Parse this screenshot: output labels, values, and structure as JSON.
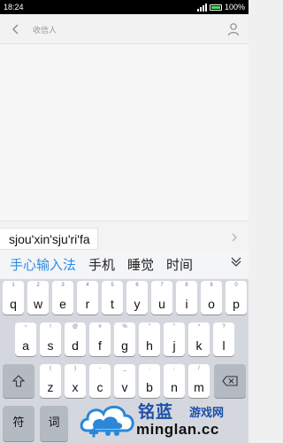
{
  "status_bar": {
    "time": "18:24",
    "battery": "100%"
  },
  "header": {
    "recipient_placeholder": "收信人",
    "back_icon": "chevron-left-icon",
    "contact_icon": "person-icon"
  },
  "compose": {
    "pinyin": "sjou'xin'sju'ri'fa",
    "send_icon": "chevron-right-icon"
  },
  "candidates": {
    "items": [
      "手心输入法",
      "手机",
      "睡觉",
      "时间"
    ],
    "expand_icon": "chevron-down-icon"
  },
  "keyboard": {
    "row1": [
      {
        "main": "q",
        "sub": "1"
      },
      {
        "main": "w",
        "sub": "2"
      },
      {
        "main": "e",
        "sub": "3"
      },
      {
        "main": "r",
        "sub": "4"
      },
      {
        "main": "t",
        "sub": "5"
      },
      {
        "main": "y",
        "sub": "6"
      },
      {
        "main": "u",
        "sub": "7"
      },
      {
        "main": "i",
        "sub": "8"
      },
      {
        "main": "o",
        "sub": "9"
      },
      {
        "main": "p",
        "sub": "0"
      }
    ],
    "row2": [
      {
        "main": "a",
        "sub": "~"
      },
      {
        "main": "s",
        "sub": "!"
      },
      {
        "main": "d",
        "sub": "@"
      },
      {
        "main": "f",
        "sub": "#"
      },
      {
        "main": "g",
        "sub": "%"
      },
      {
        "main": "h",
        "sub": "\""
      },
      {
        "main": "j",
        "sub": "\""
      },
      {
        "main": "k",
        "sub": "*"
      },
      {
        "main": "l",
        "sub": "?"
      }
    ],
    "row3": [
      {
        "main": "z",
        "sub": "("
      },
      {
        "main": "x",
        "sub": ")"
      },
      {
        "main": "c",
        "sub": "-"
      },
      {
        "main": "v",
        "sub": "_"
      },
      {
        "main": "b",
        "sub": ":"
      },
      {
        "main": "n",
        "sub": ";"
      },
      {
        "main": "m",
        "sub": "/"
      }
    ],
    "shift_icon": "shift-icon",
    "backspace_icon": "backspace-icon",
    "symbol_label": "符",
    "word_label": "词"
  },
  "watermark": {
    "brand_cn": "铭蓝",
    "brand_sub": "游戏网",
    "domain": "minglan.cc"
  },
  "colors": {
    "accent": "#2f8ce6",
    "keyboard_bg": "#d4d8de",
    "function_key": "#b4bac2",
    "watermark_blue": "#1e4fa8"
  }
}
